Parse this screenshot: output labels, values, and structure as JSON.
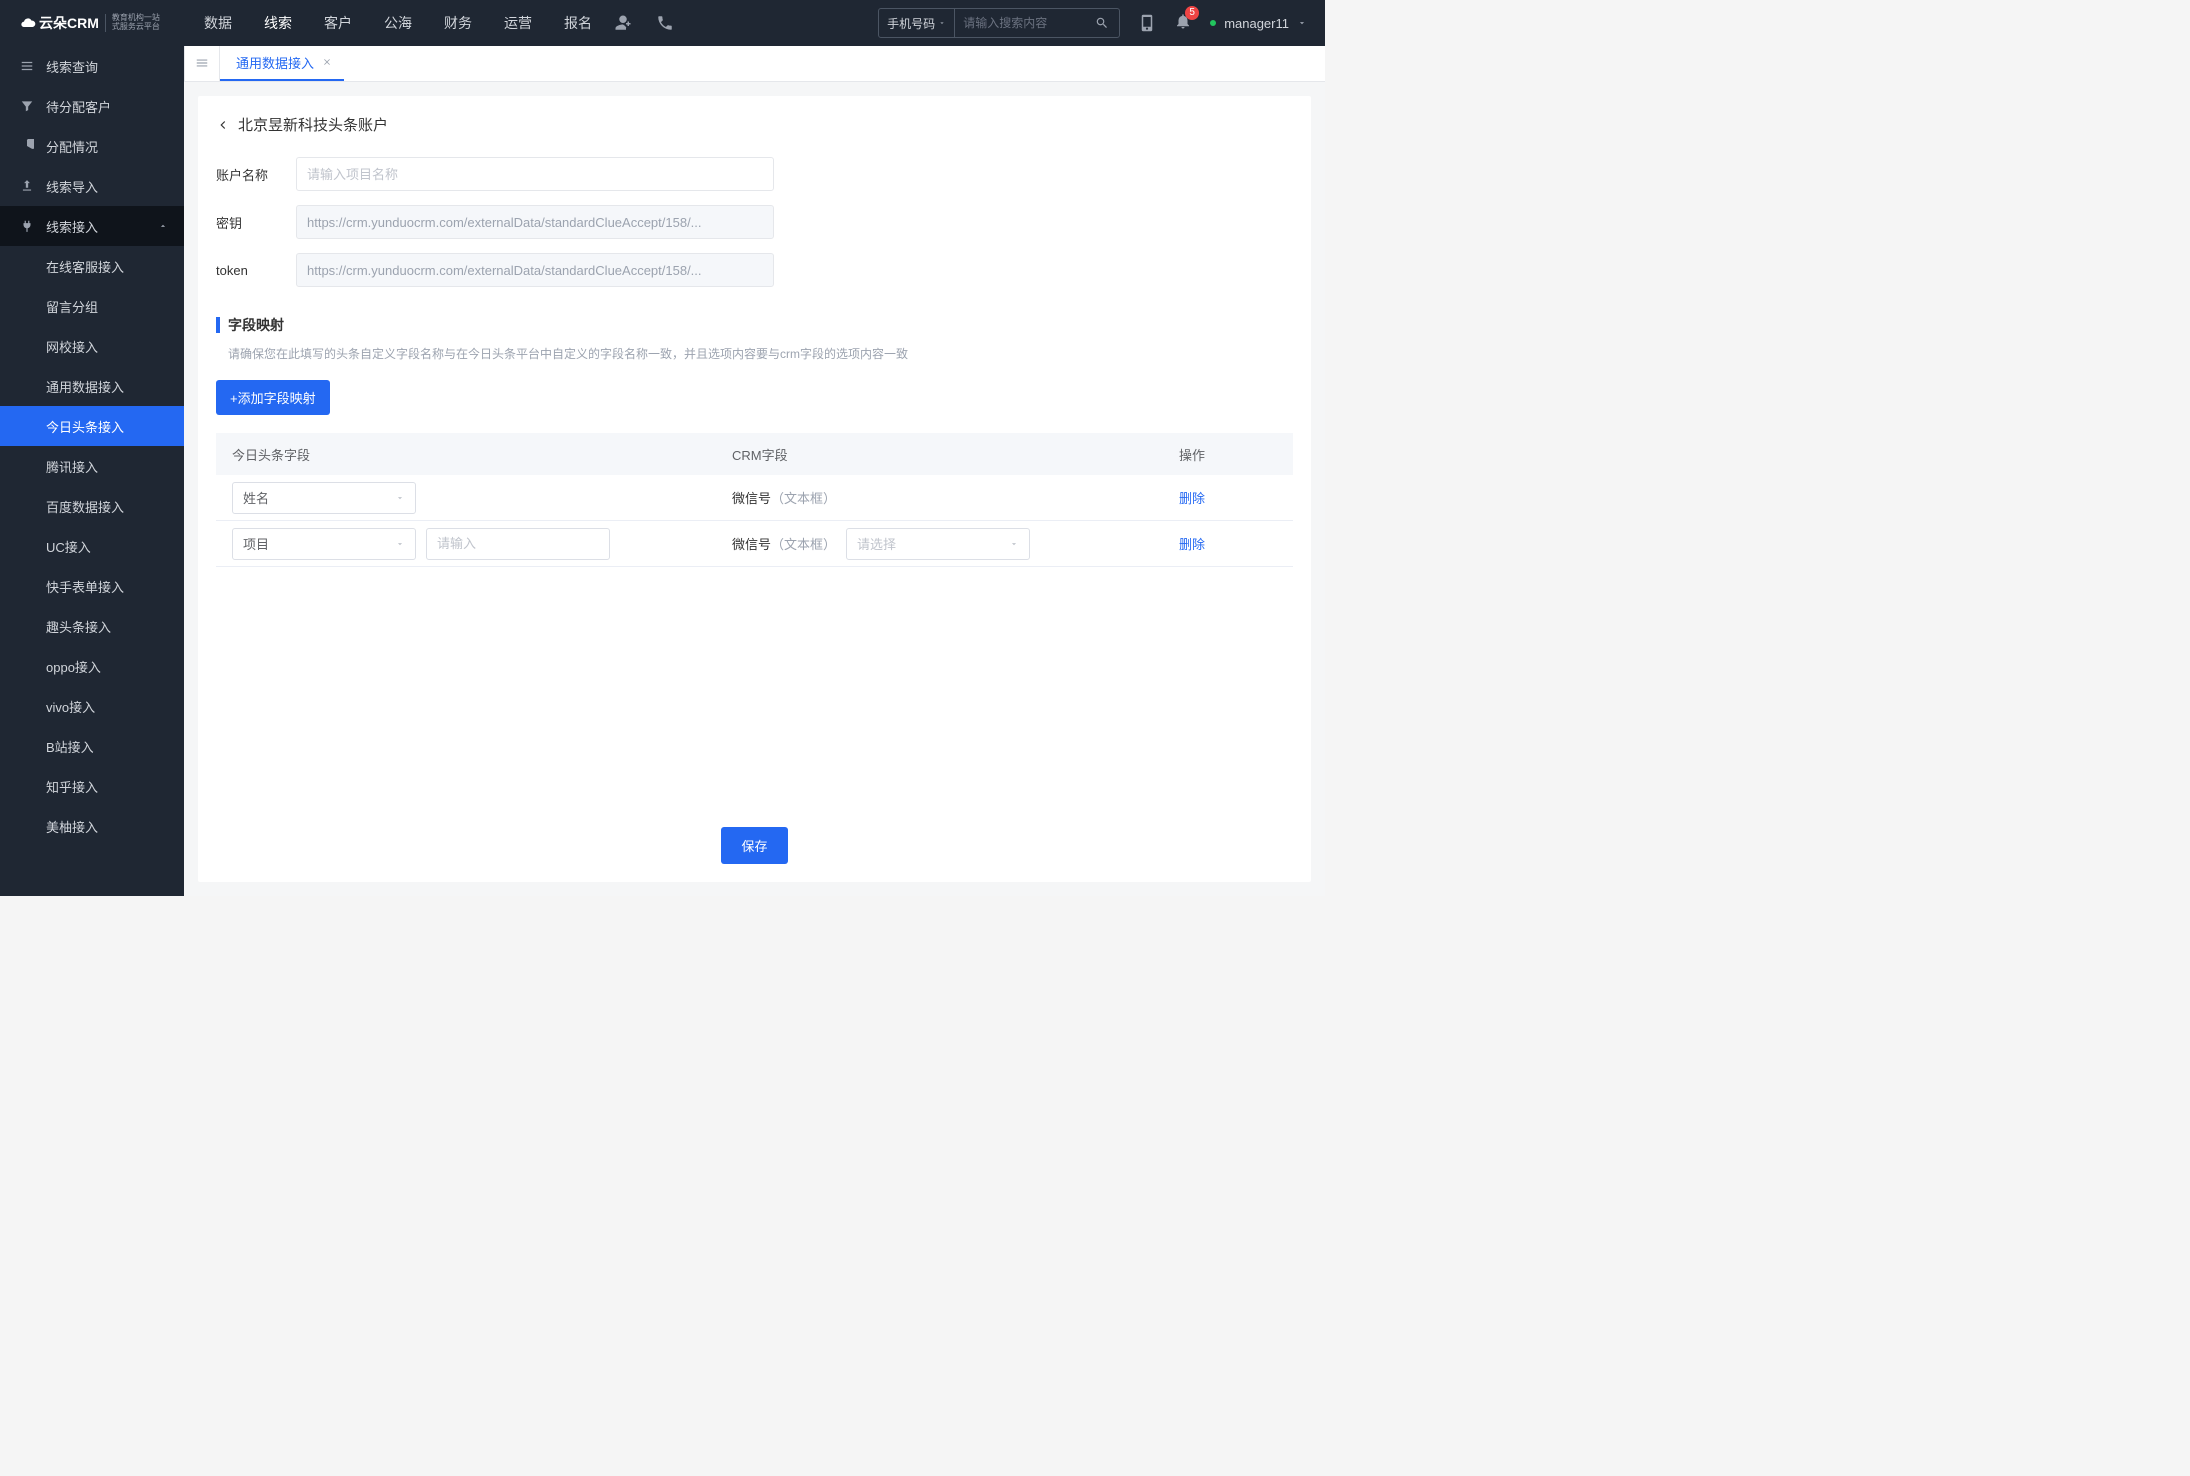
{
  "header": {
    "brand": "云朵CRM",
    "brand_sub_l1": "教育机构一站",
    "brand_sub_l2": "式服务云平台",
    "nav": [
      "数据",
      "线索",
      "客户",
      "公海",
      "财务",
      "运营",
      "报名"
    ],
    "nav_active": "线索",
    "search_select": "手机号码",
    "search_placeholder": "请输入搜索内容",
    "notif_count": "5",
    "username": "manager11"
  },
  "sidebar": {
    "items": [
      {
        "label": "线索查询"
      },
      {
        "label": "待分配客户"
      },
      {
        "label": "分配情况"
      },
      {
        "label": "线索导入"
      },
      {
        "label": "线索接入",
        "expanded": true
      }
    ],
    "sub": [
      "在线客服接入",
      "留言分组",
      "网校接入",
      "通用数据接入",
      "今日头条接入",
      "腾讯接入",
      "百度数据接入",
      "UC接入",
      "快手表单接入",
      "趣头条接入",
      "oppo接入",
      "vivo接入",
      "B站接入",
      "知乎接入",
      "美柚接入"
    ],
    "sub_active": "今日头条接入"
  },
  "tab": {
    "label": "通用数据接入"
  },
  "page": {
    "breadcrumb": "北京昱新科技头条账户",
    "labels": {
      "name": "账户名称",
      "secret": "密钥",
      "token": "token"
    },
    "name_placeholder": "请输入项目名称",
    "secret_value": "https://crm.yunduocrm.com/externalData/standardClueAccept/158/...",
    "token_value": "https://crm.yunduocrm.com/externalData/standardClueAccept/158/...",
    "section_title": "字段映射",
    "section_desc": "请确保您在此填写的头条自定义字段名称与在今日头条平台中自定义的字段名称一致，并且选项内容要与crm字段的选项内容一致",
    "add_btn": "+添加字段映射",
    "table": {
      "headers": [
        "今日头条字段",
        "CRM字段",
        "操作"
      ],
      "rows": [
        {
          "field": "姓名",
          "crm_label": "微信号",
          "crm_type": "（文本框）",
          "hasInput": false,
          "hasSelect": false
        },
        {
          "field": "项目",
          "crm_label": "微信号",
          "crm_type": "（文本框）",
          "hasInput": true,
          "input_placeholder": "请输入",
          "hasSelect": true,
          "select_placeholder": "请选择"
        }
      ],
      "delete_label": "删除"
    },
    "save_btn": "保存"
  }
}
